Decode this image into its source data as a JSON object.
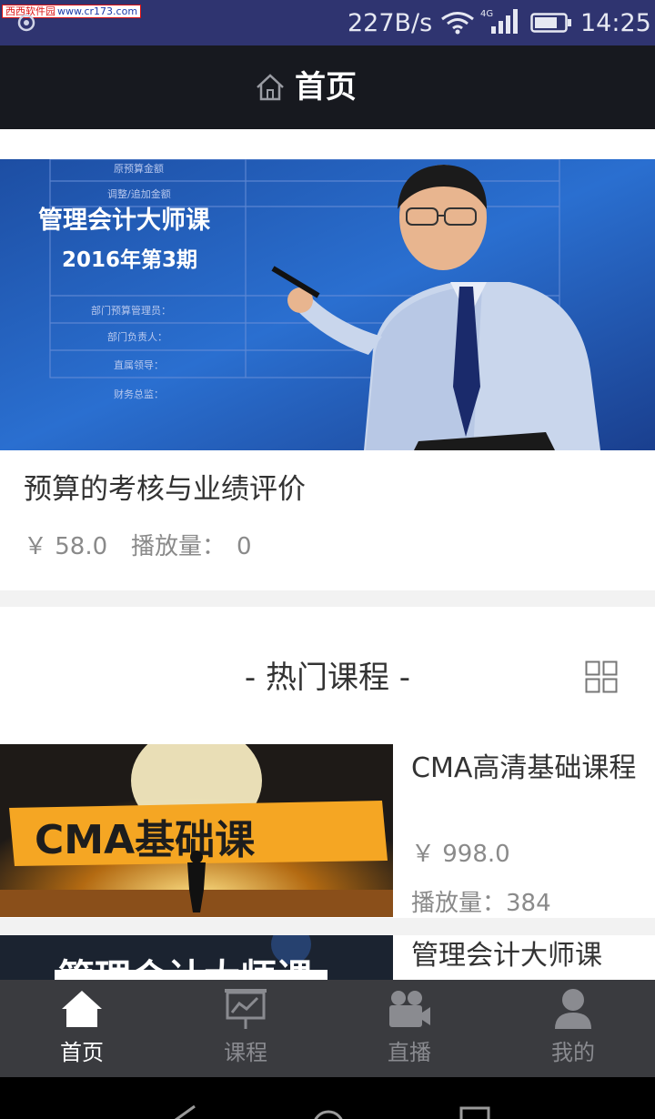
{
  "status_bar": {
    "watermark_cn": "西西软件园",
    "watermark_url": "www.cr173.com",
    "net_speed": "227B/s",
    "network_type": "4G",
    "time": "14:25",
    "background_color": "#2f3470"
  },
  "header": {
    "icon": "home-outline-icon",
    "title": "首页"
  },
  "featured": {
    "banner_heading": "管理会计大师课",
    "banner_subheading": "2016年第3期",
    "banner_table_rows": [
      "原预算金额",
      "调整/追加金额",
      "部门预算管理员：",
      "部门负责人：",
      "直属领导：",
      "财务总监："
    ],
    "title": "预算的考核与业绩评价",
    "price": "￥ 58.0",
    "plays_label": "播放量：",
    "plays_value": "0"
  },
  "hot_section": {
    "title": "- 热门课程 -",
    "view_toggle_icon": "grid-view-icon",
    "courses": [
      {
        "thumb_text": "CMA基础课",
        "name": "CMA高清基础课程",
        "price": "￥ 998.0",
        "plays": "播放量：384"
      },
      {
        "thumb_text": "管理会计大师课",
        "name": "管理会计大师课"
      }
    ]
  },
  "tabbar": {
    "background_color": "#3a3b3f",
    "tabs": [
      {
        "label": "首页",
        "icon": "home-icon",
        "active": true
      },
      {
        "label": "课程",
        "icon": "presentation-icon",
        "active": false
      },
      {
        "label": "直播",
        "icon": "video-camera-icon",
        "active": false
      },
      {
        "label": "我的",
        "icon": "user-icon",
        "active": false
      }
    ]
  }
}
